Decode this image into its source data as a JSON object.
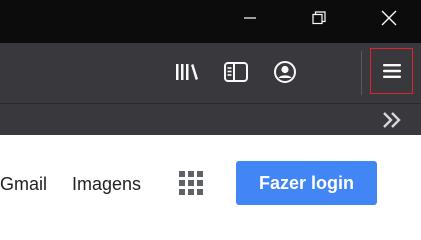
{
  "window_controls": {
    "minimize_icon": "minimize-icon",
    "restore_icon": "restore-icon",
    "close_icon": "close-icon"
  },
  "toolbar": {
    "library_icon": "library-icon",
    "sidebar_icon": "sidebar-icon",
    "account_icon": "account-icon",
    "menu_icon": "hamburger-menu-icon",
    "menu_highlight_color": "#e0242a"
  },
  "bookmarks_bar": {
    "overflow_icon": "double-chevron-right-icon"
  },
  "google_header": {
    "gmail_label": "Gmail",
    "images_label": "Imagens",
    "apps_icon": "apps-grid-icon",
    "login_label": "Fazer login",
    "login_color": "#4285f4"
  }
}
